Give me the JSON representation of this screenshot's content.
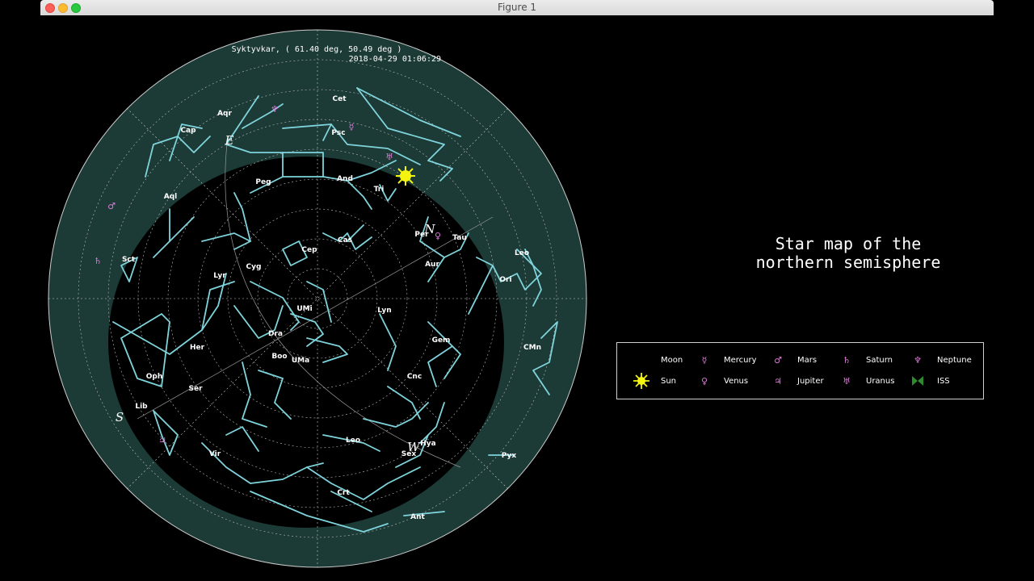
{
  "window": {
    "title": "Figure 1"
  },
  "plot": {
    "location_text": "Syktyvkar, ( 61.40 deg, 50.49 deg )",
    "datetime_text": "2018-04-29 01:06:29",
    "colors": {
      "background": "#000000",
      "outer_band": "#1c3a36",
      "constellation_lines": "#7fd4dc",
      "grid": "#bbbbbb",
      "label": "#ffffff",
      "planet": "#d97bd6",
      "sun": "#f4f410",
      "moon": "#d07060",
      "iss": "#2e8b2e"
    },
    "constellation_labels": [
      "Cet",
      "Aqr",
      "Cap",
      "Psc",
      "Peg",
      "And",
      "Tri",
      "Aql",
      "Per",
      "Tau",
      "Cas",
      "Cep",
      "Sct",
      "Lyr",
      "Cyg",
      "Aur",
      "Leo",
      "Ori",
      "UMi",
      "Lyn",
      "Dra",
      "Her",
      "Boo",
      "UMa",
      "Gem",
      "CMn",
      "Oph",
      "Ser",
      "Cnc",
      "Lib",
      "Hya",
      "Sex",
      "Pyx",
      "Vir",
      "Crt",
      "Ant",
      "Leo"
    ],
    "direction_marks": [
      "E",
      "N",
      "S",
      "W"
    ]
  },
  "title": {
    "line1": "Star map of the",
    "line2": "northern semisphere"
  },
  "legend": {
    "items": [
      {
        "label": "Moon",
        "icon": "moon-icon"
      },
      {
        "label": "Mercury",
        "icon": "mercury-icon"
      },
      {
        "label": "Mars",
        "icon": "mars-icon"
      },
      {
        "label": "Saturn",
        "icon": "saturn-icon"
      },
      {
        "label": "Neptune",
        "icon": "neptune-icon"
      },
      {
        "label": "Sun",
        "icon": "sun-icon"
      },
      {
        "label": "Venus",
        "icon": "venus-icon"
      },
      {
        "label": "Jupiter",
        "icon": "jupiter-icon"
      },
      {
        "label": "Uranus",
        "icon": "uranus-icon"
      },
      {
        "label": "ISS",
        "icon": "iss-icon"
      }
    ]
  }
}
